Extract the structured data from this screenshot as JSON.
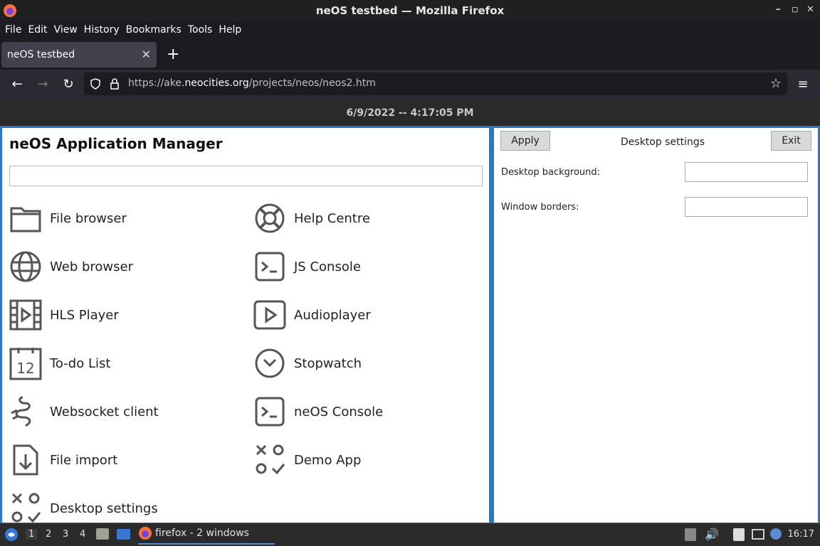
{
  "window": {
    "title": "neOS testbed — Mozilla Firefox"
  },
  "menu": [
    "File",
    "Edit",
    "View",
    "History",
    "Bookmarks",
    "Tools",
    "Help"
  ],
  "tab": {
    "title": "neOS testbed"
  },
  "url": {
    "prefix": "https://ake.",
    "domain": "neocities.org",
    "path": "/projects/neos/neos2.htm"
  },
  "clock": "6/9/2022 -- 4:17:05 PM",
  "app_manager": {
    "title": "neOS Application Manager",
    "search_value": "",
    "apps_left": [
      {
        "label": "File browser",
        "icon": "folder-icon"
      },
      {
        "label": "Web browser",
        "icon": "globe-icon"
      },
      {
        "label": "HLS Player",
        "icon": "film-icon"
      },
      {
        "label": "To-do List",
        "icon": "calendar-icon"
      },
      {
        "label": "Websocket client",
        "icon": "plug-icon"
      },
      {
        "label": "File import",
        "icon": "file-import-icon"
      },
      {
        "label": "Desktop settings",
        "icon": "apps-icon"
      }
    ],
    "apps_right": [
      {
        "label": "Help Centre",
        "icon": "lifebuoy-icon"
      },
      {
        "label": "JS Console",
        "icon": "terminal-icon"
      },
      {
        "label": "Audioplayer",
        "icon": "play-icon"
      },
      {
        "label": "Stopwatch",
        "icon": "clock-icon"
      },
      {
        "label": "neOS Console",
        "icon": "terminal-icon"
      },
      {
        "label": "Demo App",
        "icon": "apps-icon"
      }
    ]
  },
  "settings": {
    "apply_label": "Apply",
    "title": "Desktop settings",
    "exit_label": "Exit",
    "background_label": "Desktop background:",
    "background_value": "",
    "borders_label": "Window borders:",
    "borders_value": ""
  },
  "taskbar": {
    "workspaces": [
      "1",
      "2",
      "3",
      "4"
    ],
    "task_label": "firefox - 2 windows",
    "time": "16:17"
  }
}
